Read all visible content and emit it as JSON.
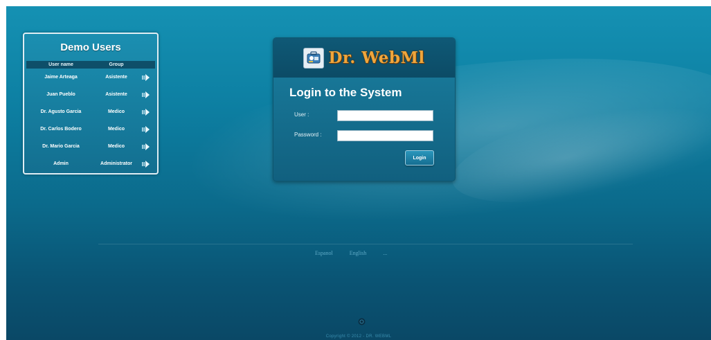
{
  "demo_users": {
    "title": "Demo Users",
    "columns": [
      "User name",
      "Group"
    ],
    "rows": [
      {
        "name": "Jaime Arteaga",
        "group": "Asistente"
      },
      {
        "name": "Juan Pueblo",
        "group": "Asistente"
      },
      {
        "name": "Dr. Agusto Garcia",
        "group": "Medico"
      },
      {
        "name": "Dr. Carlos Bodero",
        "group": "Medico"
      },
      {
        "name": "Dr. Mario Garcia",
        "group": "Medico"
      },
      {
        "name": "Admin",
        "group": "Administrator"
      }
    ],
    "row_icon": "arrow-right-icon"
  },
  "login": {
    "logo_text": "Dr. WebMl",
    "logo_icon": "medical-kit-icon",
    "title": "Login to the System",
    "user_label": "User :",
    "user_value": "",
    "password_label": "Password :",
    "password_value": "",
    "button_label": "Login"
  },
  "footer": {
    "languages": [
      "Espanol",
      "English",
      "..."
    ],
    "copyright": "Copyright © 2012 - DR. WEBML",
    "logo_icon": "footer-logo-icon"
  },
  "colors": {
    "background": "#0d7fa2",
    "panel": "#136f90",
    "logo_text": "#f0a63c"
  }
}
